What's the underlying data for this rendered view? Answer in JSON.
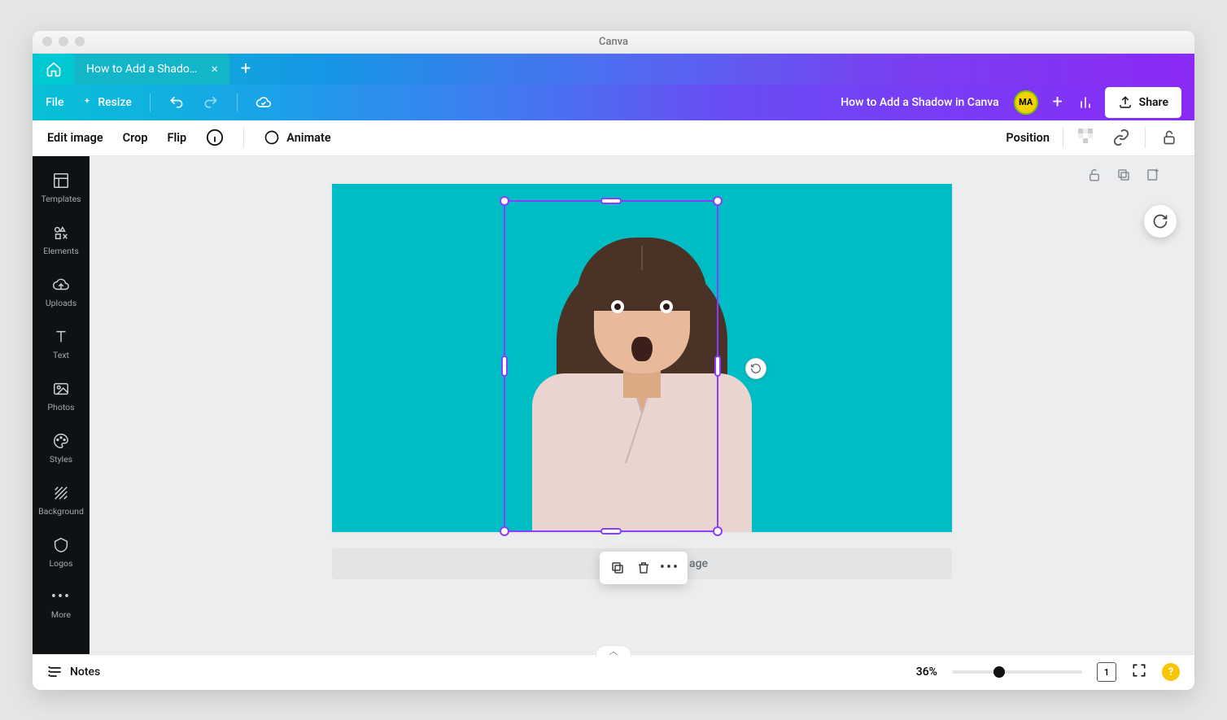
{
  "window": {
    "title": "Canva"
  },
  "tabs": {
    "active_title": "How to Add a Shadow ..."
  },
  "header": {
    "file": "File",
    "resize": "Resize",
    "doc_title": "How to Add a Shadow in Canva",
    "avatar_initials": "MA",
    "share": "Share"
  },
  "context_bar": {
    "edit_image": "Edit image",
    "crop": "Crop",
    "flip": "Flip",
    "animate": "Animate",
    "position": "Position"
  },
  "sidebar": {
    "items": [
      {
        "label": "Templates"
      },
      {
        "label": "Elements"
      },
      {
        "label": "Uploads"
      },
      {
        "label": "Text"
      },
      {
        "label": "Photos"
      },
      {
        "label": "Styles"
      },
      {
        "label": "Background"
      },
      {
        "label": "Logos"
      },
      {
        "label": "More"
      }
    ]
  },
  "canvas": {
    "background_color": "#00bcc4",
    "add_page_label": "age",
    "selected_image_description": "Surprised woman with long brown hair wearing light pink blouse"
  },
  "footer": {
    "notes": "Notes",
    "zoom_label": "36%",
    "zoom_fraction": 0.36,
    "page_count": "1"
  }
}
